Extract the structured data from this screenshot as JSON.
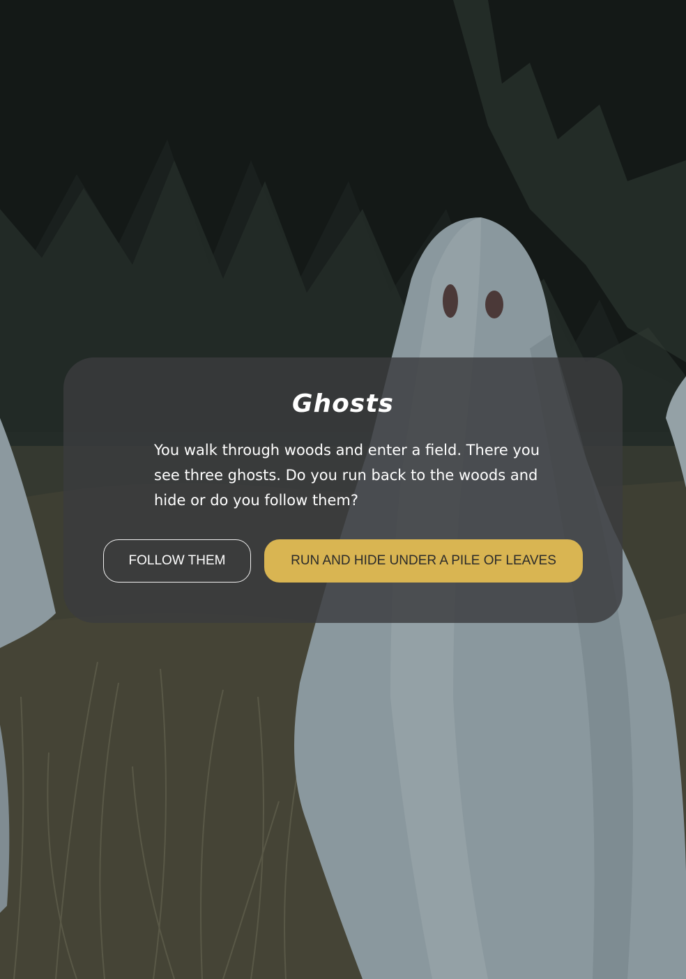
{
  "story": {
    "title": "Ghosts",
    "text": "You walk through woods and enter a field. There you see three ghosts. Do you run back to the woods and hide or do you follow them?"
  },
  "choices": {
    "follow_label": "FOLLOW THEM",
    "hide_label": "RUN AND HIDE UNDER A PILE OF LEAVES"
  },
  "colors": {
    "accent": "#d9b552",
    "card_background": "rgba(58,60,62,0.82)",
    "text": "#ffffff"
  }
}
